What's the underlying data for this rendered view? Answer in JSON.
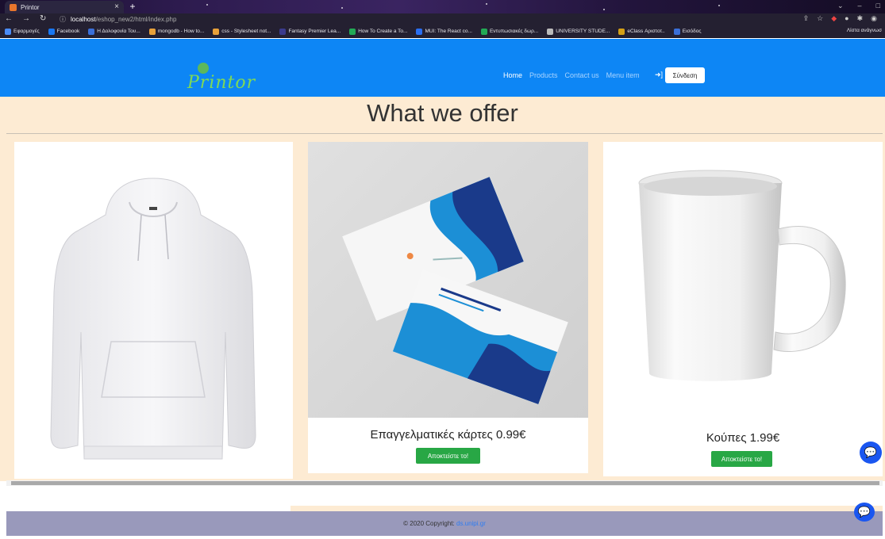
{
  "browser": {
    "tab_title": "Printor",
    "url_host": "localhost",
    "url_path": "/eshop_new2/html/index.php",
    "bookmarks": [
      "Εφαρμογές",
      "Facebook",
      "Η Δολοφονία Του...",
      "mongodb - How to...",
      "css - Stylesheet not...",
      "Fantasy Premier Lea...",
      "How To Create a To...",
      "MUI: The React co...",
      "Εντυπωσιακές δωρ...",
      "UNIVERSITY STUDE...",
      "eClass Αριστοτ..",
      "Εισόδος"
    ],
    "bookmark_colors": [
      "#4a8cf7",
      "#1877f2",
      "#3a6fd8",
      "#e8a13a",
      "#e8a13a",
      "#3a3a8c",
      "#22aa55",
      "#2a6ef0",
      "#22aa55",
      "#bbbbbb",
      "#d4a017",
      "#3a6fd8"
    ],
    "reading_list": "Λίστα ανάγνωσ"
  },
  "navbar": {
    "logo_text": "Printor",
    "menu": [
      "Home",
      "Products",
      "Contact us",
      "Menu item"
    ],
    "login_label": "Σύνδεση"
  },
  "main": {
    "heading": "What we offer",
    "cards": [
      {
        "title": "",
        "button": ""
      },
      {
        "title": "Επαγγελματικές κάρτες 0.99€",
        "button": "Αποκτείστε το!"
      },
      {
        "title": "Κούπες 1.99€",
        "button": "Αποκτείστε το!"
      }
    ]
  },
  "footer": {
    "text": "© 2020 Copyright: ",
    "link": "ds.unipi.gr"
  }
}
